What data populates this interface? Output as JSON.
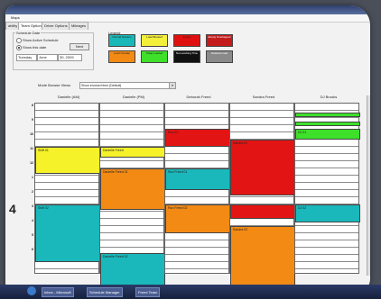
{
  "menubar": {
    "menu": "Maps"
  },
  "tabs": [
    "ability",
    "Team Options",
    "Driver Options",
    "Mileages"
  ],
  "schedule_panel": {
    "title": "Schedule Date",
    "radio_all": "Show Active Schedule",
    "radio_date": "Show this date",
    "next_button": "Next",
    "day_field": "Tuesday",
    "month_field": "June",
    "date_field": "30, 2009"
  },
  "legend": {
    "title": "Legend",
    "items": [
      {
        "label": "Normal Session",
        "color": "#19b8b8"
      },
      {
        "label": "Load Booked",
        "color": "#f4f03a"
      },
      {
        "label": "Empty",
        "color": "#e01010"
      },
      {
        "label": "Empty Overlapped",
        "color": "#c41c1c"
      },
      {
        "label": "Load Overlap",
        "color": "#f28a14"
      },
      {
        "label": "Swap Loaded",
        "color": "#3ee02a"
      },
      {
        "label": "Non-working Time",
        "color": "#111111"
      },
      {
        "label": "Deleted Load",
        "color": "#8a8a8a"
      }
    ]
  },
  "mode": {
    "label": "Mode Browse Views",
    "value": "Show invoiced time [Default]"
  },
  "columns": [
    "Danielle (AM)",
    "Danielle (PM)",
    "Deborah Freed",
    "Sandra Freed",
    "DJ Brooks"
  ],
  "times": [
    "8",
    "9",
    "10",
    "11",
    "12",
    "1",
    "2",
    "3",
    "4",
    "5",
    "6"
  ],
  "big_time": "4",
  "events": [
    {
      "col": 0,
      "text": "Shift 01",
      "color": "#f6f22a"
    },
    {
      "col": 0,
      "text": "Shift 02",
      "color": "#1ab8bb"
    },
    {
      "col": 1,
      "text": "Danielle Freed",
      "color": "#f6f22a"
    },
    {
      "col": 1,
      "text": "Danielle Freed 01",
      "color": "#f28a14"
    },
    {
      "col": 1,
      "text": "Danielle Freed 02",
      "color": "#1ab8bb"
    },
    {
      "col": 2,
      "text": "Run 01",
      "color": "#e31414"
    },
    {
      "col": 2,
      "text": "Run Freed 01",
      "color": "#1ab8bb"
    },
    {
      "col": 2,
      "text": "Run Freed 02",
      "color": "#f28a14"
    },
    {
      "col": 3,
      "text": "Sandra 01",
      "color": "#e31414"
    },
    {
      "col": 3,
      "text": "",
      "color": "#e31414"
    },
    {
      "col": 3,
      "text": "Sandra 02",
      "color": "#f28a14"
    },
    {
      "col": 4,
      "text": "",
      "color": "#3ee02a"
    },
    {
      "col": 4,
      "text": "",
      "color": "#3ee02a"
    },
    {
      "col": 4,
      "text": "DJ 01",
      "color": "#3ee02a"
    },
    {
      "col": 4,
      "text": "DJ 02",
      "color": "#1ab8bb"
    }
  ],
  "taskbar": [
    "Inbox - Microsoft",
    "Schedule Manager",
    "Freed Team"
  ]
}
